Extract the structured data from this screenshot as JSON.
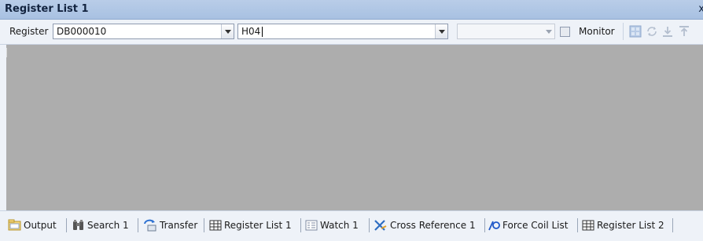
{
  "window": {
    "title": "Register List 1",
    "close_glyph": "x"
  },
  "toolbar": {
    "register_label": "Register",
    "register_value": "DB000010",
    "format_value": "H04",
    "third_value": "",
    "monitor_label": "Monitor",
    "monitor_checked": false,
    "icons": [
      "register-grid-icon",
      "refresh-icon",
      "download-icon",
      "upload-icon"
    ]
  },
  "tabs": [
    {
      "label": "Output",
      "icon": "output-icon"
    },
    {
      "label": "Search 1",
      "icon": "binoculars-icon"
    },
    {
      "label": "Transfer",
      "icon": "transfer-icon"
    },
    {
      "label": "Register List 1",
      "icon": "table-icon",
      "active": true
    },
    {
      "label": "Watch 1",
      "icon": "watch-icon"
    },
    {
      "label": "Cross Reference 1",
      "icon": "cross-reference-icon"
    },
    {
      "label": "Force Coil List",
      "icon": "force-coil-icon"
    },
    {
      "label": "Register List 2",
      "icon": "table-icon"
    }
  ],
  "colors": {
    "title_bar": "#b0c7e5",
    "workspace": "#adadad",
    "panel": "#eef2f8"
  }
}
